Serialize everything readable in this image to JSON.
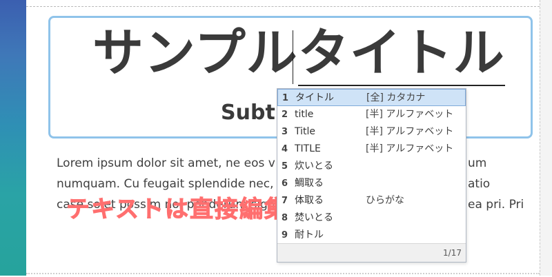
{
  "editor": {
    "title_plain": "サンプル",
    "title_composing": "タイトル",
    "subtitle": "Subtit",
    "body_lines": [
      "Lorem ipsum dolor sit amet, ne eos v",
      "numquam. Cu feugait splendide nec,",
      "",
      "case solet possim no, ponderum sign"
    ],
    "body_right_lines": [
      "um",
      "atio",
      "ea pri. Pri",
      ""
    ]
  },
  "overlay": {
    "caption": "テキストは直接編集！"
  },
  "ime": {
    "candidates": [
      {
        "num": "1",
        "text": "タイトル",
        "note": "[全] カタカナ"
      },
      {
        "num": "2",
        "text": "title",
        "note": "[半] アルファベット"
      },
      {
        "num": "3",
        "text": "Title",
        "note": "[半] アルファベット"
      },
      {
        "num": "4",
        "text": "TITLE",
        "note": "[半] アルファベット"
      },
      {
        "num": "5",
        "text": "炊いとる",
        "note": ""
      },
      {
        "num": "6",
        "text": "鯛取る",
        "note": ""
      },
      {
        "num": "7",
        "text": "体取る",
        "note": "ひらがな"
      },
      {
        "num": "8",
        "text": "焚いとる",
        "note": ""
      },
      {
        "num": "9",
        "text": "耐トル",
        "note": ""
      }
    ],
    "selected_index": 0,
    "page": "1/17"
  }
}
